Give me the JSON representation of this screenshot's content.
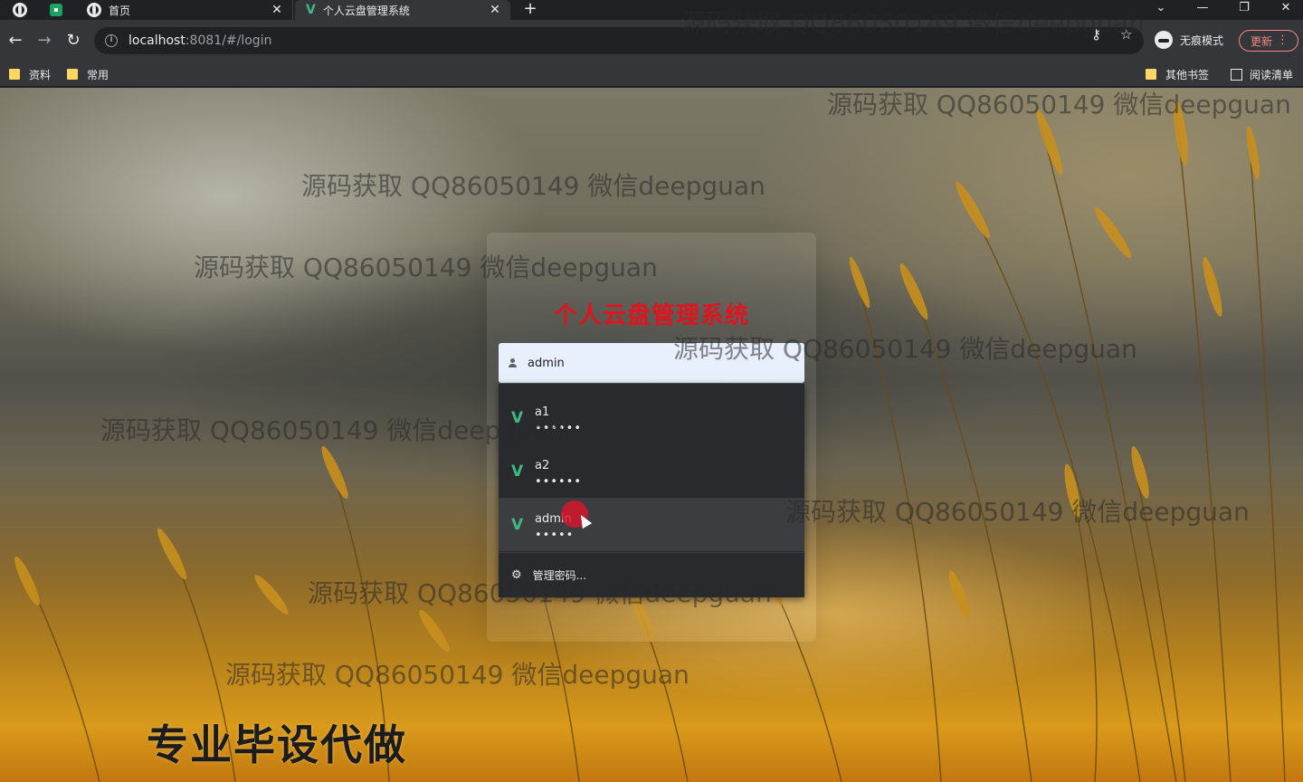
{
  "tabs": [
    {
      "title": "首页",
      "icon": "globe-icon"
    },
    {
      "title": "个人云盘管理系统",
      "icon": "vue-logo-icon"
    }
  ],
  "window_controls": {
    "chevron": "⌄",
    "minimize": "—",
    "restore": "❐",
    "close": "✕"
  },
  "address_bar": {
    "url_host": "localhost",
    "url_rest": ":8081/#/login",
    "profile_label": "无痕模式",
    "update_label": "更新"
  },
  "bookmarks": {
    "left": [
      {
        "label": "资料"
      },
      {
        "label": "常用"
      }
    ],
    "other": "其他书签",
    "reading_list": "阅读清单"
  },
  "login": {
    "app_title": "个人云盘管理系统",
    "username_value": "admin"
  },
  "autofill": {
    "items": [
      {
        "user": "a1",
        "password": "••••••"
      },
      {
        "user": "a2",
        "password": "••••••"
      },
      {
        "user": "admin",
        "password": "•••••"
      }
    ],
    "manage_label": "管理密码..."
  },
  "watermark_text": "源码获取 QQ86050149 微信deepguan",
  "promo_text": "专业毕设代做",
  "colors": {
    "title_red": "#e0141e",
    "vue_green": "#41b883",
    "update_red": "#f28b82"
  }
}
